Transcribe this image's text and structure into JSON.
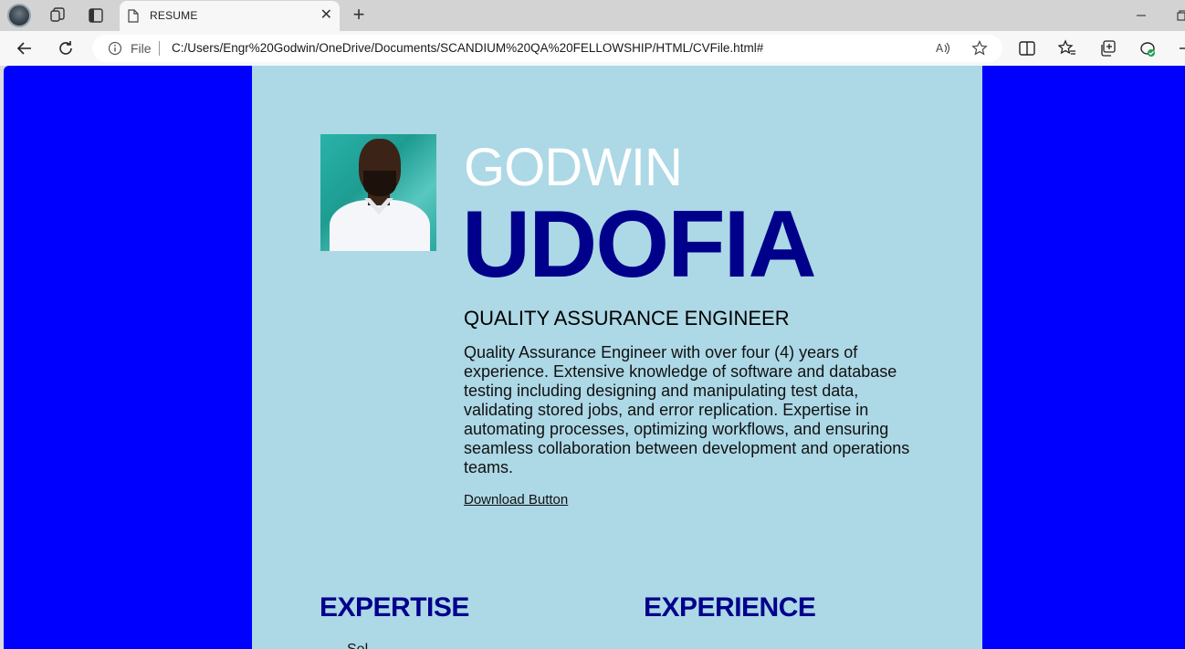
{
  "browser": {
    "tab_title": "RESUME",
    "tab_close": "✕",
    "new_tab": "+",
    "address_prefix": "File",
    "url": "C:/Users/Engr%20Godwin/OneDrive/Documents/SCANDIUM%20QA%20FELLOWSHIP/HTML/CVFile.html#"
  },
  "resume": {
    "first_name": "GODWIN",
    "last_name": "UDOFIA",
    "job_title": "QUALITY ASSURANCE ENGINEER",
    "summary": "Quality Assurance Engineer with over four (4) years of experience. Extensive knowledge of software and database testing including designing and manipulating test data, validating stored jobs, and error replication. Expertise in automating processes, optimizing workflows, and ensuring seamless collaboration between development and operations teams.",
    "download_label": "Download Button",
    "sections": {
      "expertise": "EXPERTISE",
      "experience": "EXPERIENCE"
    },
    "expertise_first_item": "Sel..."
  },
  "colors": {
    "page_background": "#0000ff",
    "resume_background": "#add8e6",
    "accent_navy": "#00008b",
    "name_white": "#ffffff"
  },
  "icons": [
    "profile-icon",
    "workspaces-icon",
    "tab-actions-icon",
    "page-icon",
    "back-icon",
    "reload-icon",
    "info-icon",
    "read-aloud-icon",
    "star-icon",
    "split-screen-icon",
    "favorites-icon",
    "collections-icon",
    "extension-icon",
    "minimize-icon",
    "restore-icon"
  ]
}
